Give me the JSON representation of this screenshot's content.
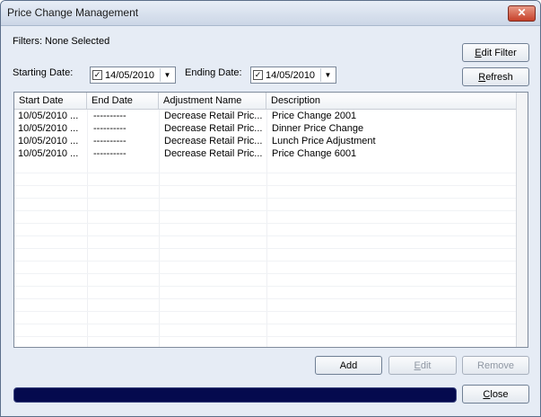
{
  "window": {
    "title": "Price Change Management"
  },
  "filters": {
    "text": "Filters: None Selected"
  },
  "dates": {
    "start_label": "Starting Date:",
    "start_value": "14/05/2010",
    "start_checked": "✓",
    "end_label": "Ending Date:",
    "end_value": "14/05/2010",
    "end_checked": "✓"
  },
  "buttons": {
    "edit_filter": {
      "prefix": "",
      "hotkey": "E",
      "rest": "dit Filter"
    },
    "refresh": {
      "prefix": "",
      "hotkey": "R",
      "rest": "efresh"
    },
    "add": "Add",
    "edit": {
      "prefix": "",
      "hotkey": "E",
      "rest": "dit"
    },
    "remove": "Remove",
    "close": {
      "prefix": "",
      "hotkey": "C",
      "rest": "lose"
    }
  },
  "table": {
    "columns": [
      "Start Date",
      "End Date",
      "Adjustment Name",
      "Description"
    ],
    "rows": [
      [
        "10/05/2010 ...",
        "----------",
        "Decrease Retail Pric...",
        "Price Change 2001"
      ],
      [
        "10/05/2010 ...",
        "----------",
        "Decrease Retail Pric...",
        "Dinner Price Change"
      ],
      [
        "10/05/2010 ...",
        "----------",
        "Decrease Retail Pric...",
        "Lunch Price Adjustment"
      ],
      [
        "10/05/2010 ...",
        "----------",
        "Decrease Retail Pric...",
        "Price Change 6001"
      ]
    ]
  },
  "icons": {
    "close": "close-icon",
    "dropdown": "chevron-down-icon"
  },
  "colors": {
    "progress": "#050a4e",
    "close_button": "#c7412a"
  }
}
